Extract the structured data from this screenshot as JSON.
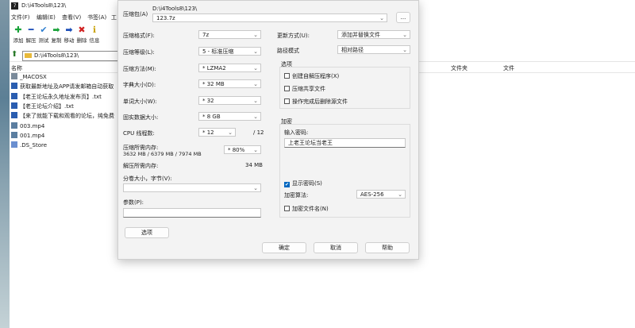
{
  "background": {
    "title": "D:\\i4Tools8\\123\\",
    "menu": [
      "文件(F)",
      "编辑(E)",
      "查看(V)",
      "书签(A)",
      "工"
    ],
    "toolbar": [
      {
        "label": "添加",
        "icon": "add-icon",
        "glyph": "✚",
        "color": "#1aa33a"
      },
      {
        "label": "解压",
        "icon": "extract-icon",
        "glyph": "━",
        "color": "#1d4fb8"
      },
      {
        "label": "测试",
        "icon": "test-icon",
        "glyph": "✔",
        "color": "#2f7fd0"
      },
      {
        "label": "复制",
        "icon": "copy-icon",
        "glyph": "➡",
        "color": "#1aa33a"
      },
      {
        "label": "移动",
        "icon": "move-icon",
        "glyph": "➡",
        "color": "#1d4fb8"
      },
      {
        "label": "删除",
        "icon": "delete-icon",
        "glyph": "✖",
        "color": "#d02020"
      },
      {
        "label": "信息",
        "icon": "info-icon",
        "glyph": "ℹ",
        "color": "#c8a000"
      }
    ],
    "address": "D:\\i4Tools8\\123\\",
    "columns": {
      "name": "名称",
      "folder": "文件夹",
      "file": "文件"
    },
    "files": [
      {
        "name": "_MACOSX",
        "icon": "folder-icon",
        "color": "#7a8a9a"
      },
      {
        "name": "获取最新地址及APP请发邮箱自动获取",
        "icon": "text-file-icon",
        "color": "#2a5db0"
      },
      {
        "name": "【老王论坛永久地址发布页】.txt",
        "icon": "text-file-icon",
        "color": "#2a5db0"
      },
      {
        "name": "【老王论坛介绍】.txt",
        "icon": "text-file-icon",
        "color": "#2a5db0"
      },
      {
        "name": "【来了就能下载和观看的论坛，纯免费",
        "icon": "text-file-icon",
        "color": "#2a5db0"
      },
      {
        "name": "003.mp4",
        "icon": "video-file-icon",
        "color": "#5b7ea0"
      },
      {
        "name": "001.mp4",
        "icon": "video-file-icon",
        "color": "#5b7ea0"
      },
      {
        "name": ".DS_Store",
        "icon": "file-icon",
        "color": "#6a8fd0"
      }
    ]
  },
  "dialog": {
    "archive_label": "压缩包(A)",
    "archive_path": "D:\\i4Tools8\\123\\",
    "archive_name": "123.7z",
    "browse_label": "...",
    "format_label": "压缩格式(F):",
    "format_value": "7z",
    "level_label": "压缩等级(L):",
    "level_value": "5 - 标准压缩",
    "method_label": "压缩方法(M):",
    "method_value": "* LZMA2",
    "dict_label": "字典大小(D):",
    "dict_value": "* 32 MB",
    "word_label": "单词大小(W):",
    "word_value": "* 32",
    "solid_label": "固实数据大小:",
    "solid_value": "* 8 GB",
    "cpu_label": "CPU 线程数:",
    "cpu_value": "* 12",
    "cpu_total": "/ 12",
    "mem_comp_label": "压缩所需内存:",
    "mem_comp_value": "3632 MB / 6379 MB / 7974 MB",
    "mem_comp_percent": "* 80%",
    "mem_decomp_label": "解压所需内存:",
    "mem_decomp_value": "34 MB",
    "split_label": "分卷大小，字节(V):",
    "split_value": "",
    "params_label": "参数(P):",
    "params_value": "",
    "options_button": "选项",
    "update_label": "更新方式(U):",
    "update_value": "添加并替换文件",
    "path_label": "路径模式",
    "path_value": "相对路径",
    "options_group": "选项",
    "opt_sfx": "创建自解压程序(X)",
    "opt_shared": "压缩共享文件",
    "opt_delete": "操作完成后删除源文件",
    "enc_group": "加密",
    "password_label": "输入密码:",
    "password_value": "上老王论坛当老王",
    "show_password": "显示密码(S)",
    "enc_method_label": "加密算法:",
    "enc_method_value": "AES-256",
    "encrypt_names": "加密文件名(N)",
    "ok": "确定",
    "cancel": "取消",
    "help": "帮助"
  }
}
